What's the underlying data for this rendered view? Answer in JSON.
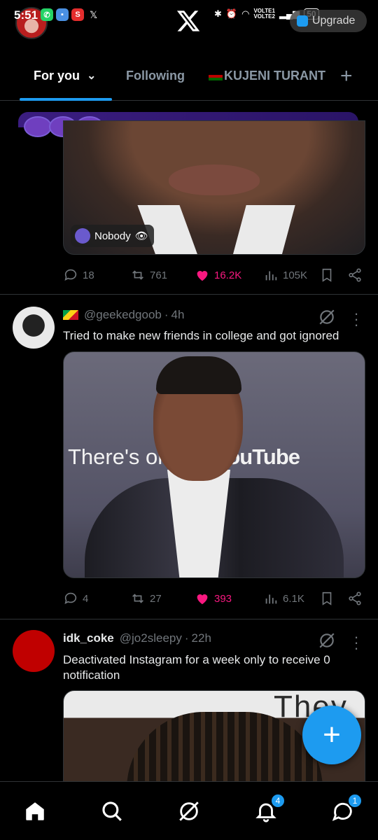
{
  "status_bar": {
    "time": "5:51",
    "battery": "50",
    "network_label": "VOLTE",
    "upgrade_label": "Upgrade"
  },
  "tabs": [
    {
      "label": "For you",
      "active": true
    },
    {
      "label": "Following",
      "active": false
    },
    {
      "label": "KUJENI TURANT",
      "active": false
    }
  ],
  "accent_color": "#1d9bf0",
  "like_color": "#f91880",
  "tweets": [
    {
      "media_label": "Nobody",
      "actions": {
        "replies": "18",
        "retweets": "761",
        "likes": "16.2K",
        "views": "105K",
        "liked": true
      }
    },
    {
      "handle": "@geekedgoob",
      "time": "4h",
      "text": "Tried to make new friends in college and got ignored",
      "media_text_left": "There's onl",
      "media_text_right": "YouTube",
      "actions": {
        "replies": "4",
        "retweets": "27",
        "likes": "393",
        "views": "6.1K",
        "liked": true
      }
    },
    {
      "name": "idk_coke",
      "handle": "@jo2sleepy",
      "time": "22h",
      "text": "Deactivated Instagram for a week only to receive 0 notification",
      "media_text": "They"
    }
  ],
  "bottom_nav": {
    "notifications_badge": "4",
    "messages_badge": "1"
  }
}
